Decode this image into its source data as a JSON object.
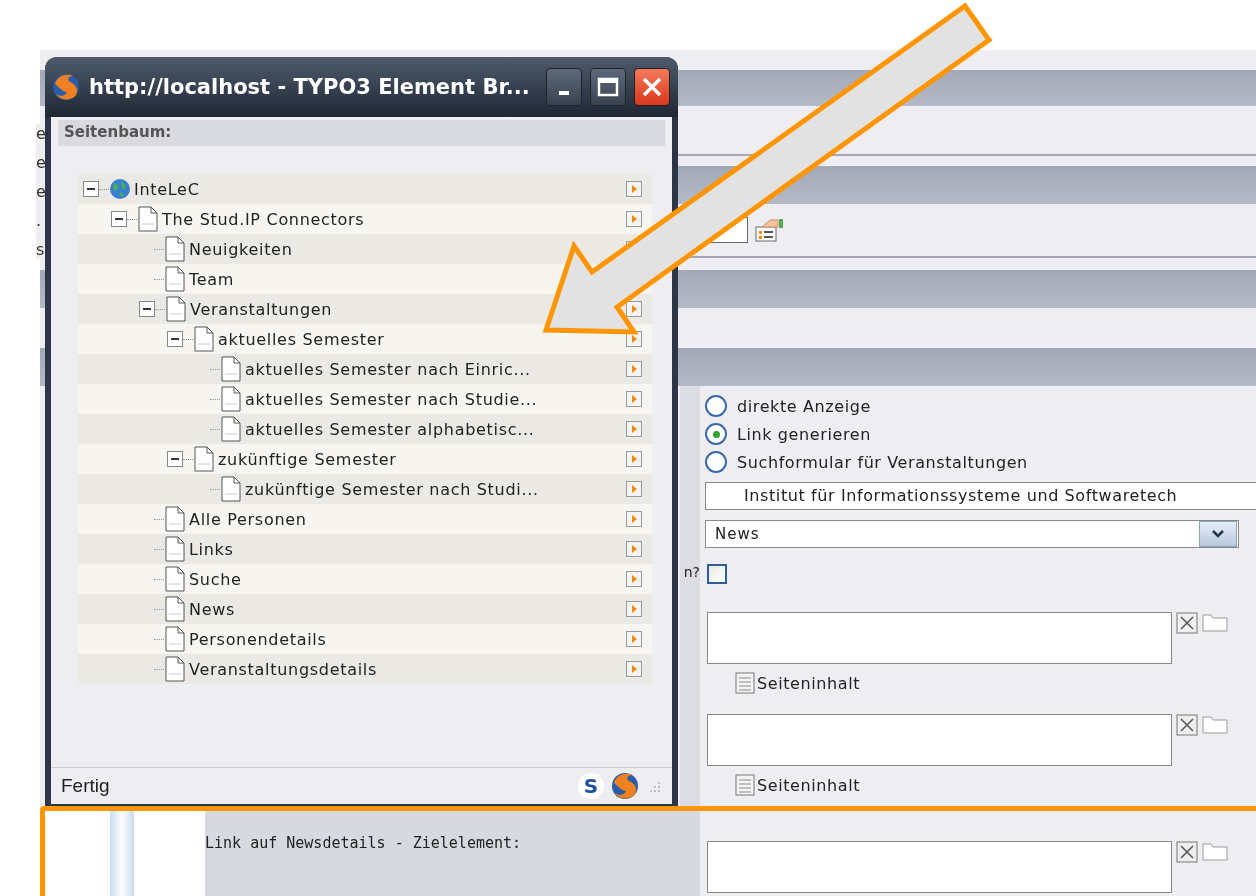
{
  "background_page": {
    "left_fragments": [
      "e",
      "e",
      "e",
      ".",
      "s"
    ],
    "link_type_options": [
      {
        "label": "direkte Anzeige",
        "selected": false
      },
      {
        "label": "Link generieren",
        "selected": true
      },
      {
        "label": "Suchformular für Veranstaltungen",
        "selected": false
      }
    ],
    "institute_field": {
      "value": "Institut für Informationssysteme und Softwaretech"
    },
    "view_select": {
      "value": "News"
    },
    "checkbox_row": {
      "label": "n?",
      "checked": false
    },
    "element_fields": [
      {
        "link": "Seiteninhalt"
      },
      {
        "link": "Seiteninhalt"
      }
    ],
    "newsdetails_field": {
      "label": "Link auf Newsdetails - Zielelement:"
    }
  },
  "popup": {
    "title": "http://localhost - TYPO3 Element Br...",
    "section": "Seitenbaum:",
    "tree": [
      {
        "label": "InteLeC",
        "kind": "site",
        "expanded": true,
        "children": [
          {
            "label": "The Stud.IP Connectors",
            "kind": "page",
            "expanded": true,
            "children": [
              {
                "label": "Neuigkeiten",
                "kind": "page"
              },
              {
                "label": "Team",
                "kind": "page"
              },
              {
                "label": "Veranstaltungen",
                "kind": "page",
                "expanded": true,
                "children": [
                  {
                    "label": "aktuelles Semester",
                    "kind": "page",
                    "expanded": true,
                    "children": [
                      {
                        "label": "aktuelles Semester nach Einric...",
                        "kind": "page"
                      },
                      {
                        "label": "aktuelles Semester nach Studie...",
                        "kind": "page"
                      },
                      {
                        "label": "aktuelles Semester alphabetisc...",
                        "kind": "page"
                      }
                    ]
                  },
                  {
                    "label": "zukünftige Semester",
                    "kind": "page",
                    "expanded": true,
                    "children": [
                      {
                        "label": "zukünftige Semester nach Studi...",
                        "kind": "page"
                      }
                    ]
                  }
                ]
              },
              {
                "label": "Alle Personen",
                "kind": "page"
              },
              {
                "label": "Links",
                "kind": "page"
              },
              {
                "label": "Suche",
                "kind": "page"
              },
              {
                "label": "News",
                "kind": "page"
              },
              {
                "label": "Personendetails",
                "kind": "page"
              },
              {
                "label": "Veranstaltungsdetails",
                "kind": "page"
              }
            ]
          }
        ]
      }
    ],
    "status": "Fertig",
    "status_badge": "S"
  }
}
